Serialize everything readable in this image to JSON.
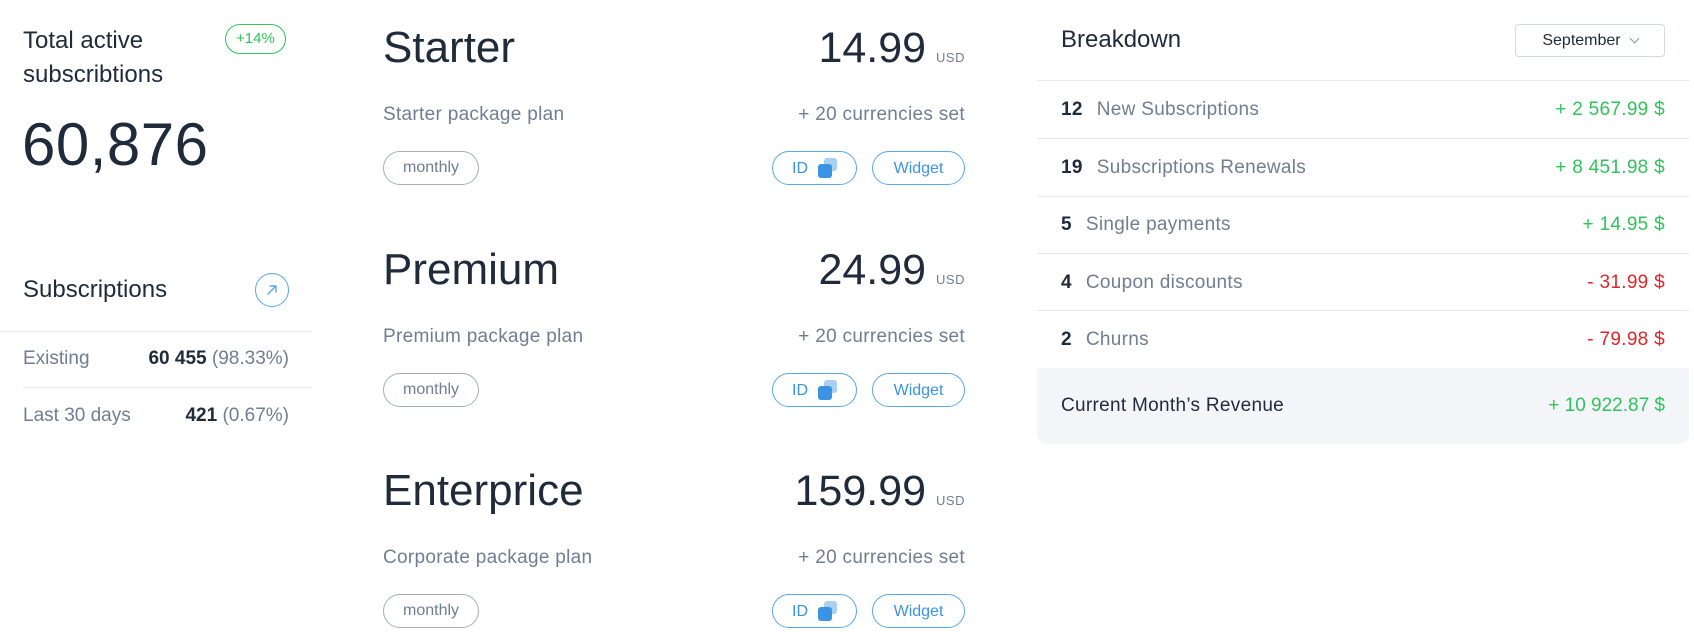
{
  "summary": {
    "title": "Total active subscribtions",
    "change_badge": "+14%",
    "change_color": "#2fc45a",
    "total": "60,876"
  },
  "subscriptions": {
    "title": "Subscriptions",
    "link_icon": "arrow-up-right-icon",
    "rows": [
      {
        "label": "Existing",
        "value": "60 455",
        "pct": "(98.33%)"
      },
      {
        "label": "Last 30 days",
        "value": "421",
        "pct": "(0.67%)"
      }
    ]
  },
  "plans": [
    {
      "name": "Starter",
      "description": "Starter package plan",
      "price": "14.99",
      "currency": "USD",
      "currencies": "+ 20 currencies set",
      "period": "monthly",
      "id_label": "ID",
      "widget_label": "Widget"
    },
    {
      "name": "Premium",
      "description": "Premium package plan",
      "price": "24.99",
      "currency": "USD",
      "currencies": "+ 20 currencies set",
      "period": "monthly",
      "id_label": "ID",
      "widget_label": "Widget"
    },
    {
      "name": "Enterprice",
      "description": "Corporate package plan",
      "price": "159.99",
      "currency": "USD",
      "currencies": "+ 20 currencies set",
      "period": "monthly",
      "id_label": "ID",
      "widget_label": "Widget"
    }
  ],
  "breakdown": {
    "title": "Breakdown",
    "month": "September",
    "rows": [
      {
        "count": "12",
        "label": "New Subscriptions",
        "amount": "+ 2 567.99 $",
        "sign": "pos"
      },
      {
        "count": "19",
        "label": "Subscriptions Renewals",
        "amount": "+ 8 451.98 $",
        "sign": "pos"
      },
      {
        "count": "5",
        "label": "Single payments",
        "amount": "+ 14.95 $",
        "sign": "pos"
      },
      {
        "count": "4",
        "label": "Coupon discounts",
        "amount": "- 31.99 $",
        "sign": "neg"
      },
      {
        "count": "2",
        "label": "Churns",
        "amount": "- 79.98 $",
        "sign": "neg"
      }
    ],
    "revenue_label": "Current Month’s Revenue",
    "revenue_amount": "+ 10 922.87 $"
  },
  "colors": {
    "positive": "#2fc45a",
    "negative": "#e0262b",
    "accent": "#3b93e3",
    "text_primary": "#1f2a3a",
    "text_secondary": "#717d91"
  }
}
